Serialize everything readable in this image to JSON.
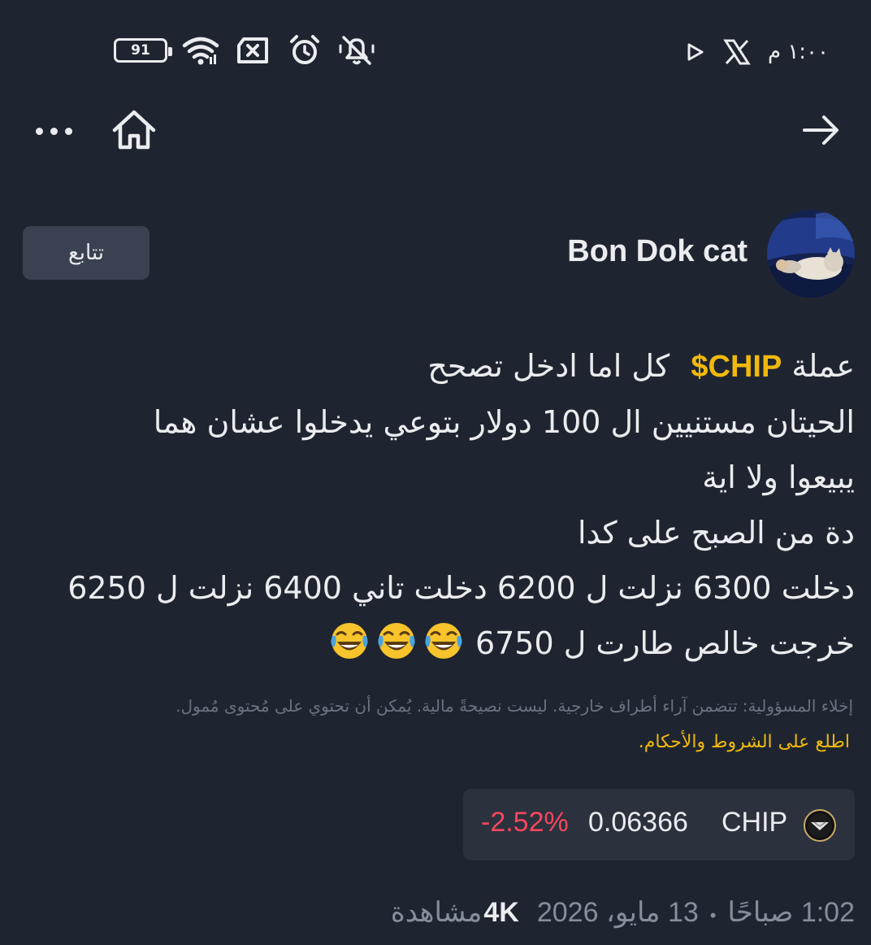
{
  "status_bar": {
    "time": "١:٠٠ م",
    "battery_level": "91",
    "icons": [
      "battery-icon",
      "wifi-icon",
      "no-sim-icon",
      "alarm-icon",
      "notifications-off-icon",
      "x-app-icon",
      "play-store-icon"
    ]
  },
  "nav": {
    "more_icon": "more-dots-icon",
    "home_icon": "home-icon",
    "back_icon": "arrow-right-icon"
  },
  "author": {
    "name": "Bon Dok cat",
    "follow_label": "تتابع"
  },
  "post": {
    "line1_prefix": "عملة",
    "cashtag": "$CHIP",
    "line1_suffix": "كل اما ادخل تصحح",
    "line2": "الحيتان مستنيين ال 100 دولار بتوعي يدخلوا عشان هما",
    "line3": "يبيعوا ولا اية",
    "line4": "دة من الصبح على كدا",
    "line5": "دخلت 6300 نزلت ل 6200 دخلت تاني 6400 نزلت ل 6250",
    "line6": "خرجت خالص طارت ل 6750",
    "emojis": [
      "laughing-tears-emoji",
      "laughing-tears-emoji",
      "laughing-tears-emoji"
    ]
  },
  "disclaimer": {
    "text": "إخلاء المسؤولية: تتضمن آراء أطراف خارجية. ليست نصيحةً مالية. يُمكن أن تحتوي على مُحتوى مُمول.",
    "link_label": "اطلع على الشروط والأحكام."
  },
  "ticker": {
    "symbol": "CHIP",
    "price": "0.06366",
    "change": "-2.52%",
    "coin_icon": "chip-coin-icon",
    "change_color": "#f6465d"
  },
  "meta": {
    "time": "1:02 صباحًا",
    "date": "13 مايو، 2026",
    "views_count": "4K",
    "views_label": "مشاهدة"
  },
  "colors": {
    "background": "#1f2530",
    "accent": "#f0b90b",
    "negative": "#f6465d",
    "muted": "#848e9c"
  }
}
